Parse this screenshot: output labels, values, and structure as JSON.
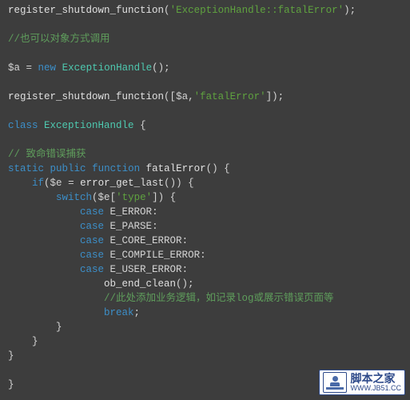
{
  "code": {
    "l01_fn": "register_shutdown_function",
    "l01_p1": "(",
    "l01_s": "'ExceptionHandle::fatalError'",
    "l01_p2": ");",
    "l03_c": "//也可以对象方式调用",
    "l05_v": "$a",
    "l05_eq": " = ",
    "l05_new": "new",
    "l05_sp": " ",
    "l05_cls": "ExceptionHandle",
    "l05_end": "();",
    "l07_fn": "register_shutdown_function",
    "l07_p1": "([",
    "l07_v": "$a",
    "l07_c": ",",
    "l07_s": "'fatalError'",
    "l07_p2": "]);",
    "l09_kw": "class",
    "l09_sp": " ",
    "l09_cls": "ExceptionHandle",
    "l09_br": " {",
    "l11_c": "// 致命错误捕获",
    "l12_kw1": "static",
    "l12_kw2": "public",
    "l12_kw3": "function",
    "l12_name": "fatalError",
    "l12_end": "() {",
    "l13_if": "if",
    "l13_p1": "(",
    "l13_v": "$e",
    "l13_eq": " = ",
    "l13_fn": "error_get_last",
    "l13_p2": "()) {",
    "l14_sw": "switch",
    "l14_p1": "(",
    "l14_v": "$e",
    "l14_br": "[",
    "l14_s": "'type'",
    "l14_p2": "]) {",
    "l15_kw": "case",
    "l15_c": "E_ERROR",
    "l15_e": ":",
    "l16_kw": "case",
    "l16_c": "E_PARSE",
    "l16_e": ":",
    "l17_kw": "case",
    "l17_c": "E_CORE_ERROR",
    "l17_e": ":",
    "l18_kw": "case",
    "l18_c": "E_COMPILE_ERROR",
    "l18_e": ":",
    "l19_kw": "case",
    "l19_c": "E_USER_ERROR",
    "l19_e": ":",
    "l20_fn": "ob_end_clean",
    "l20_e": "();",
    "l21_c": "//此处添加业务逻辑，如记录log或展示错误页面等",
    "l22_kw": "break",
    "l22_e": ";",
    "l23": "}",
    "l24": "}",
    "l25": "}",
    "l27": "}"
  },
  "watermark": {
    "title": "脚本之家",
    "url": "WWW.JB51.CC"
  }
}
